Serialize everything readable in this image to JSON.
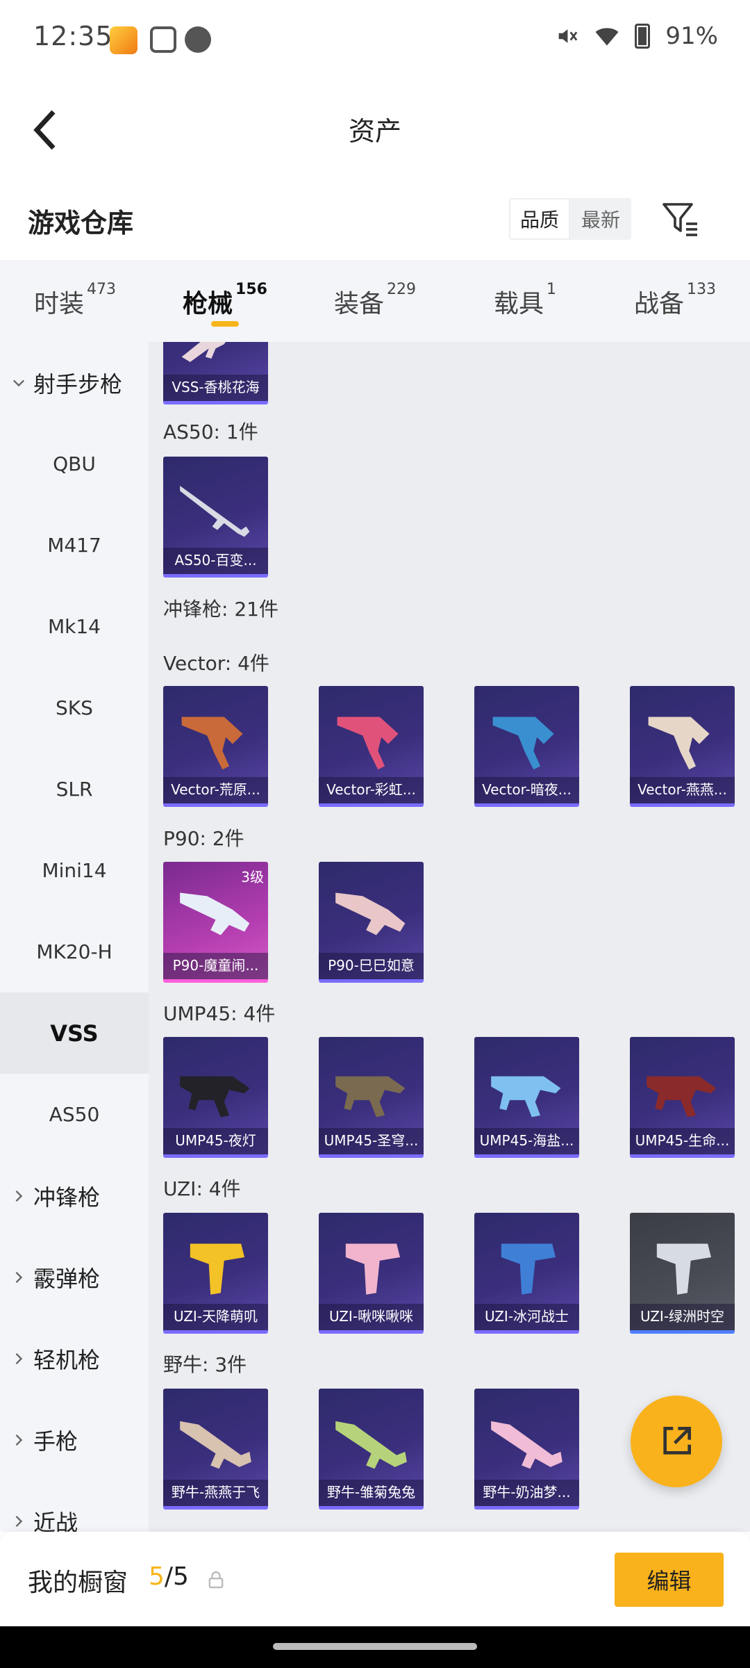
{
  "status_bar": {
    "time": "12:35",
    "battery": "91%"
  },
  "header": {
    "title": "资产"
  },
  "warehouse": {
    "title": "游戏仓库",
    "sort_quality": "品质",
    "sort_newest": "最新"
  },
  "tabs": [
    {
      "label": "时装",
      "count": "473"
    },
    {
      "label": "枪械",
      "count": "156"
    },
    {
      "label": "装备",
      "count": "229"
    },
    {
      "label": "载具",
      "count": "1"
    },
    {
      "label": "战备",
      "count": "133"
    }
  ],
  "sidebar": {
    "category_open": "射手步枪",
    "items": [
      "QBU",
      "M417",
      "Mk14",
      "SKS",
      "SLR",
      "Mini14",
      "MK20-H",
      "VSS",
      "AS50"
    ],
    "active": "VSS",
    "categories": [
      "冲锋枪",
      "霰弹枪",
      "轻机枪",
      "手枪",
      "近战"
    ]
  },
  "content": {
    "top_card": "VSS-香桃花海",
    "groups": {
      "as50": {
        "label": "AS50: 1件",
        "cards": [
          "AS50-百变..."
        ]
      },
      "smg_header": "冲锋枪: 21件",
      "vector": {
        "label": "Vector: 4件",
        "cards": [
          "Vector-荒原...",
          "Vector-彩虹...",
          "Vector-暗夜...",
          "Vector-燕燕..."
        ]
      },
      "p90": {
        "label": "P90: 2件",
        "cards": [
          "P90-魔童闹...",
          "P90-巳巳如意"
        ],
        "level": "3级"
      },
      "ump45": {
        "label": "UMP45: 4件",
        "cards": [
          "UMP45-夜灯",
          "UMP45-圣穹...",
          "UMP45-海盐...",
          "UMP45-生命..."
        ]
      },
      "uzi": {
        "label": "UZI: 4件",
        "cards": [
          "UZI-天降萌叽",
          "UZI-啾咪啾咪",
          "UZI-冰河战士",
          "UZI-绿洲时空"
        ]
      },
      "bizon": {
        "label": "野牛: 3件",
        "cards": [
          "野牛-燕燕于飞",
          "野牛-雏菊兔兔",
          "野牛-奶油梦..."
        ]
      }
    }
  },
  "bottom_bar": {
    "label": "我的橱窗",
    "current": "5",
    "total": "/5",
    "edit": "编辑"
  },
  "colors": {
    "accent": "#f9b21b",
    "card_bg": "#3b2f7d",
    "card_pink": "#b43eb0"
  }
}
